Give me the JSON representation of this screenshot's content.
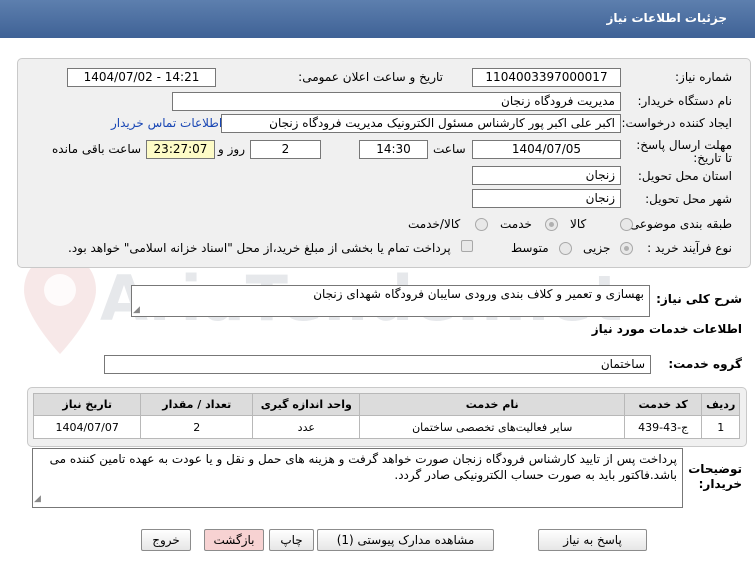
{
  "header": {
    "title": "جزئیات اطلاعات نیاز"
  },
  "watermark": "AriaTender.net",
  "form": {
    "need_number_label": "شماره نیاز:",
    "need_number": "1104003397000017",
    "announce_label": "تاریخ و ساعت اعلان عمومی:",
    "announce_value": "1404/07/02 - 14:21",
    "buyer_org_label": "نام دستگاه خریدار:",
    "buyer_org": "مدیریت فرودگاه زنجان",
    "creator_label": "ایجاد کننده درخواست:",
    "creator": "اکبر علی اکبر پور کارشناس مسئول الکترونیک مدیریت فرودگاه زنجان",
    "contact_link": "اطلاعات تماس خریدار",
    "deadline_label": "مهلت ارسال پاسخ: تا تاریخ:",
    "deadline_date": "1404/07/05",
    "time_label": "ساعت",
    "deadline_time": "14:30",
    "days_value": "2",
    "days_label": "روز و",
    "remaining_time": "23:27:07",
    "remaining_label": "ساعت باقی مانده",
    "province_label": "استان محل تحویل:",
    "province": "زنجان",
    "city_label": "شهر محل تحویل:",
    "city": "زنجان",
    "category_label": "طبقه بندی موضوعی:",
    "category_options": [
      "کالا",
      "خدمت",
      "کالا/خدمت"
    ],
    "process_label": "نوع فرآیند خرید :",
    "process_options": [
      "جزیی",
      "متوسط"
    ],
    "payment_note": "پرداخت تمام یا بخشی از مبلغ خرید،از محل \"اسناد خزانه اسلامی\" خواهد بود."
  },
  "description": {
    "label": "شرح کلی نیاز:",
    "value": "بهسازی و تعمیر و کلاف بندی ورودی سایبان فرودگاه شهدای زنجان"
  },
  "services": {
    "section_title": "اطلاعات خدمات مورد نیاز",
    "group_label": "گروه خدمت:",
    "group_value": "ساختمان",
    "columns": [
      "ردیف",
      "کد خدمت",
      "نام خدمت",
      "واحد اندازه گیری",
      "تعداد / مقدار",
      "تاریخ نیاز"
    ],
    "rows": [
      {
        "row": "1",
        "code": "ج-43-439",
        "name": "سایر فعالیت‌های تخصصی ساختمان",
        "unit": "عدد",
        "qty": "2",
        "date": "1404/07/07"
      }
    ]
  },
  "buyer_notes": {
    "label": "توضیحات خریدار:",
    "value": "پرداخت پس از تایید کارشناس فرودگاه زنجان صورت خواهد گرفت و هزینه های حمل و نقل و یا عودت به عهده تامین کننده می باشد.فاکتور باید به صورت حساب الکترونیکی صادر گردد."
  },
  "buttons": {
    "reply": "پاسخ به نیاز",
    "attachments": "مشاهده مدارک پیوستی (1)",
    "print": "چاپ",
    "back": "بازگشت",
    "exit": "خروج"
  }
}
